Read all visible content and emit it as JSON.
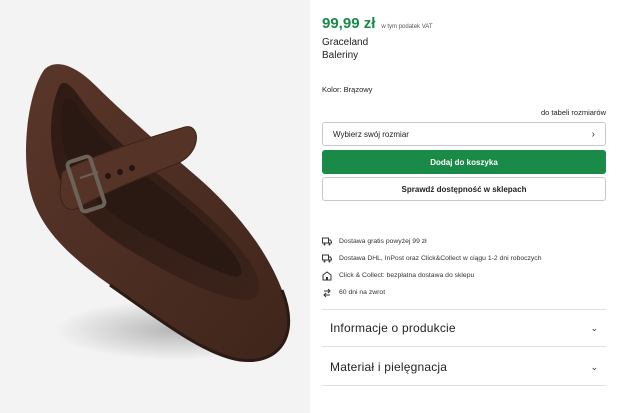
{
  "price": {
    "amount": "99,99 zł",
    "vat_note": "w tym podatek VAT"
  },
  "product": {
    "brand": "Graceland",
    "type": "Baleriny"
  },
  "color": {
    "label": "Kolor: Brązowy"
  },
  "size": {
    "table_link": "do tabeli rozmiarów",
    "select_placeholder": "Wybierz swój rozmiar"
  },
  "buttons": {
    "add_to_cart": "Dodaj do koszyka",
    "check_store": "Sprawdź dostępność w sklepach"
  },
  "delivery": [
    {
      "icon": "truck-icon",
      "text": "Dostawa gratis powyżej 99 zł"
    },
    {
      "icon": "truck-icon",
      "text": "Dostawa DHL, InPost oraz Click&Collect w ciągu 1-2 dni roboczych"
    },
    {
      "icon": "store-pickup-icon",
      "text": "Click & Collect: bezpłatna dostawa do sklepu"
    },
    {
      "icon": "return-arrows-icon",
      "text": "60 dni na zwrot"
    }
  ],
  "accordions": [
    {
      "label": "Informacje o produkcie"
    },
    {
      "label": "Materiał i pielęgnacja"
    }
  ],
  "colors": {
    "accent_green": "#1a8a48",
    "shoe_brown": "#4e2e22"
  }
}
